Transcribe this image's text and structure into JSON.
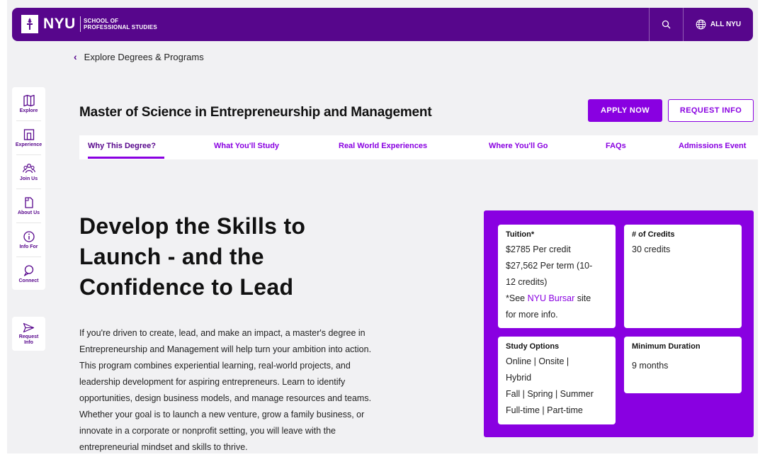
{
  "header": {
    "logo_text": "NYU",
    "school_line1": "SCHOOL OF",
    "school_line2": "PROFESSIONAL STUDIES",
    "search_icon": "search-icon",
    "all_nyu_label": "ALL NYU",
    "globe_icon": "globe-icon",
    "brand_color": "#57068c"
  },
  "breadcrumb": {
    "label": "Explore Degrees & Programs"
  },
  "sidenav": {
    "items": [
      {
        "label": "Explore",
        "icon": "map-icon"
      },
      {
        "label": "Experience",
        "icon": "building-icon"
      },
      {
        "label": "Join Us",
        "icon": "people-icon"
      },
      {
        "label": "About Us",
        "icon": "document-icon"
      },
      {
        "label": "Info For",
        "icon": "info-icon"
      },
      {
        "label": "Connect",
        "icon": "chat-icon"
      }
    ],
    "request_line1": "Request",
    "request_line2": "Info",
    "request_icon": "send-icon"
  },
  "page": {
    "title": "Master of Science in Entrepreneurship and Management",
    "apply_label": "APPLY NOW",
    "request_label": "REQUEST INFO",
    "accent_color": "#8900e1"
  },
  "tabs": [
    {
      "label": "Why This Degree?",
      "active": true
    },
    {
      "label": "What You'll Study"
    },
    {
      "label": "Real World Experiences"
    },
    {
      "label": "Where You'll Go"
    },
    {
      "label": "FAQs"
    },
    {
      "label": "Admissions Event"
    }
  ],
  "hero": {
    "title_line1": "Develop the Skills to",
    "title_line2": "Launch - and the",
    "title_line3": "Confidence to Lead",
    "body": [
      "If you're driven to create, lead, and make an impact, a master's degree in",
      "Entrepreneurship and Management will help turn your ambition into action.",
      "This program combines experiential learning, real-world projects, and",
      "leadership development for aspiring entrepreneurs. Learn to identify",
      "opportunities, design business models, and manage resources and teams.",
      "Whether your goal is to launch a new venture, grow a family business, or",
      "innovate in a corporate or nonprofit setting, you will leave with the",
      "entrepreneurial mindset and skills to thrive."
    ]
  },
  "info": {
    "tuition_head": "Tuition*",
    "tuition_lines": [
      "$2785 Per credit",
      "$27,562 Per term (10-",
      "12 credits)"
    ],
    "tuition_note_pre": "*See ",
    "tuition_note_link": "NYU Bursar",
    "tuition_note_post": " site",
    "tuition_note_line2": "for more info.",
    "credits_head": "# of Credits",
    "credits_value": "30 credits",
    "study_head": "Study Options",
    "study_lines": [
      "Online | Onsite |",
      "Hybrid",
      "Fall | Spring | Summer",
      "Full-time | Part-time"
    ],
    "duration_head": "Minimum Duration",
    "duration_value": "9 months"
  }
}
